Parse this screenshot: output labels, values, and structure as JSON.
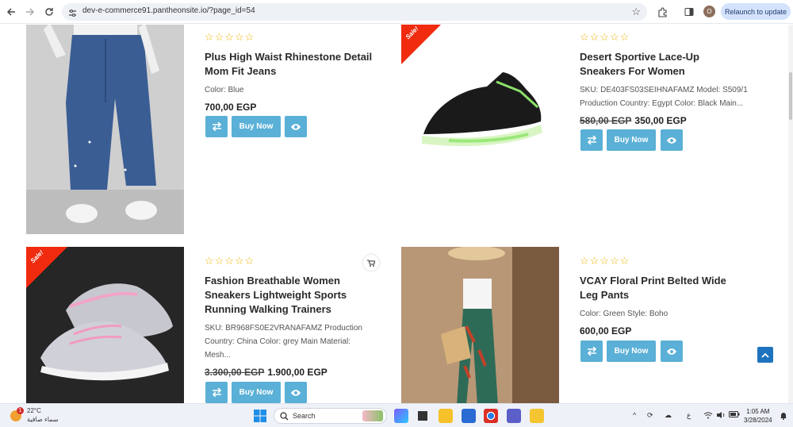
{
  "browser": {
    "url": "dev-e-commerce91.pantheonsite.io/?page_id=54",
    "relaunch_label": "Relaunch to update",
    "profile_initial": "O"
  },
  "products": [
    {
      "title_lines": [
        "Plus High Waist Rhinestone Detail",
        "Mom Fit Jeans"
      ],
      "meta_lines": [
        "Color: Blue"
      ],
      "old_price": "",
      "price": "700,00 EGP",
      "sale": false,
      "rating": "☆☆☆☆☆"
    },
    {
      "title_lines": [
        "Desert Sportive Lace-Up",
        "Sneakers For Women"
      ],
      "meta_lines": [
        "SKU: DE403FS03SEIHNAFAMZ Model: S509/1",
        "Production Country: Egypt Color: Black Main..."
      ],
      "old_price": "580,00 EGP",
      "price": "350,00 EGP",
      "sale": true,
      "sale_label": "Sale!",
      "rating": "☆☆☆☆☆"
    },
    {
      "title_lines": [
        "Fashion Breathable Women",
        "Sneakers Lightweight Sports",
        "Running Walking Trainers"
      ],
      "meta_lines": [
        "SKU: BR968FS0E2VRANAFAMZ Production",
        "Country: China Color: grey Main Material:",
        "Mesh..."
      ],
      "old_price": "3.300,00 EGP",
      "price": "1.900,00 EGP",
      "sale": true,
      "sale_label": "Sale!",
      "rating": "☆☆☆☆☆"
    },
    {
      "title_lines": [
        "VCAY Floral Print Belted Wide",
        "Leg Pants"
      ],
      "meta_lines": [
        "Color: Green Style: Boho"
      ],
      "old_price": "",
      "price": "600,00 EGP",
      "sale": false,
      "rating": "☆☆☆☆☆"
    }
  ],
  "buttons": {
    "buy_now": "Buy Now"
  },
  "taskbar": {
    "temperature": "22°C",
    "weather_text": "سماء صافية",
    "weather_badge": "1",
    "search_placeholder": "Search",
    "time": "1:05 AM",
    "date": "3/28/2024",
    "lang": "ع"
  },
  "colors": {
    "accent": "#5ab0d6",
    "sale": "#f02b0e",
    "star": "#e9b500",
    "totop": "#1e73be"
  }
}
